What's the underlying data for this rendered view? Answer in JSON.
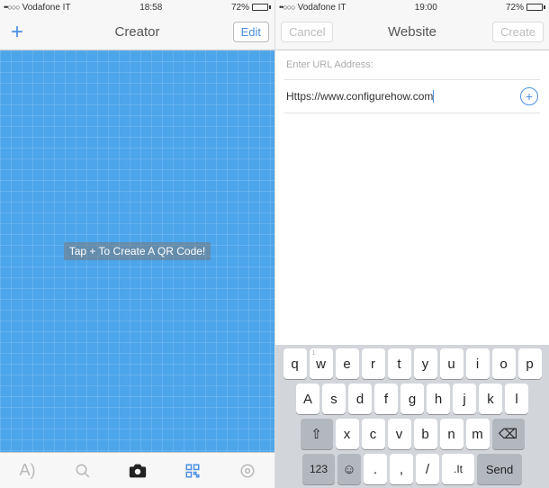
{
  "left": {
    "status": {
      "carrier": "Vodafone IT",
      "time": "18:58",
      "battery": "72%"
    },
    "nav": {
      "title": "Creator",
      "edit": "Edit",
      "add": "+"
    },
    "hint": "Tap + To Create A QR Code!",
    "tabs": {
      "text": "A)",
      "search": "search",
      "camera": "camera",
      "qr": "qr",
      "settings": "settings"
    }
  },
  "right": {
    "status": {
      "carrier": "Vodafone IT",
      "time": "19:00",
      "battery": "72%"
    },
    "nav": {
      "title": "Website",
      "cancel": "Cancel",
      "create": "Create"
    },
    "section_label": "Enter URL Address:",
    "url_value": "Https://www.configurehow.com",
    "keyboard": {
      "row1": [
        "q",
        "w",
        "e",
        "r",
        "t",
        "y",
        "u",
        "i",
        "o",
        "p"
      ],
      "row1_sub": [
        "",
        "1",
        "",
        "",
        "",
        "",
        "",
        "",
        "",
        ""
      ],
      "row2": [
        "A",
        "s",
        "d",
        "f",
        "g",
        "h",
        "j",
        "k",
        "l"
      ],
      "row3_shift": "⇧",
      "row3": [
        "x",
        "c",
        "v",
        "b",
        "n",
        "m"
      ],
      "row3_back": "⌫",
      "row4": {
        "num": "123",
        "emoji": "☺",
        "dot": ".",
        "comma": ",",
        "slash": "/",
        "it": ".It",
        "send": "Send"
      }
    }
  }
}
